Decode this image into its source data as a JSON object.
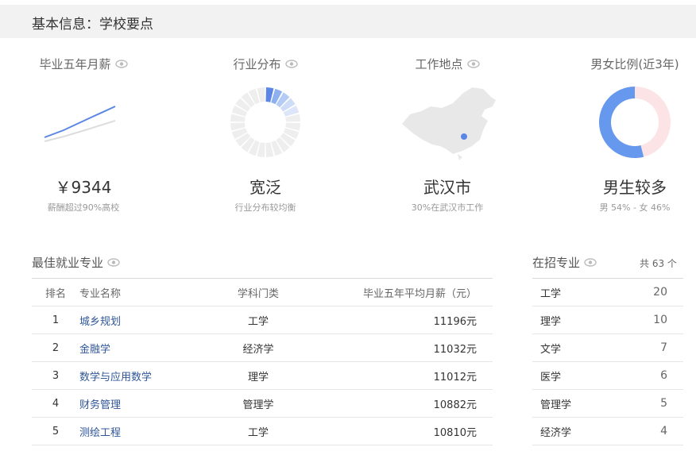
{
  "header": {
    "title": "基本信息：学校要点"
  },
  "cards": {
    "salary": {
      "title": "毕业五年月薪",
      "value": "￥9344",
      "note": "薪酬超过90%高校"
    },
    "industry": {
      "title": "行业分布",
      "value": "宽泛",
      "note": "行业分布较均衡"
    },
    "location": {
      "title": "工作地点",
      "value": "武汉市",
      "note": "30%在武汉市工作"
    },
    "gender": {
      "title": "男女比例(近3年)",
      "value": "男生较多",
      "note": "男 54% - 女 46%",
      "male_pct": 54,
      "female_pct": 46
    }
  },
  "colors": {
    "accent": "#6699ee",
    "female": "#fce4e6",
    "header_bg": "#f2f2f2",
    "link": "#2f5597"
  },
  "best_majors": {
    "title": "最佳就业专业",
    "headers": {
      "rank": "排名",
      "name": "专业名称",
      "category": "学科门类",
      "salary": "毕业五年平均月薪（元）"
    },
    "rows": [
      {
        "rank": "1",
        "name": "城乡规划",
        "category": "工学",
        "salary": "11196元"
      },
      {
        "rank": "2",
        "name": "金融学",
        "category": "经济学",
        "salary": "11032元"
      },
      {
        "rank": "3",
        "name": "数学与应用数学",
        "category": "理学",
        "salary": "11012元"
      },
      {
        "rank": "4",
        "name": "财务管理",
        "category": "管理学",
        "salary": "10882元"
      },
      {
        "rank": "5",
        "name": "测绘工程",
        "category": "工学",
        "salary": "10810元"
      }
    ]
  },
  "enrolling": {
    "title": "在招专业",
    "count": "共 63 个",
    "rows": [
      {
        "name": "工学",
        "count": "20"
      },
      {
        "name": "理学",
        "count": "10"
      },
      {
        "name": "文学",
        "count": "7"
      },
      {
        "name": "医学",
        "count": "6"
      },
      {
        "name": "管理学",
        "count": "5"
      },
      {
        "name": "经济学",
        "count": "4"
      }
    ]
  }
}
